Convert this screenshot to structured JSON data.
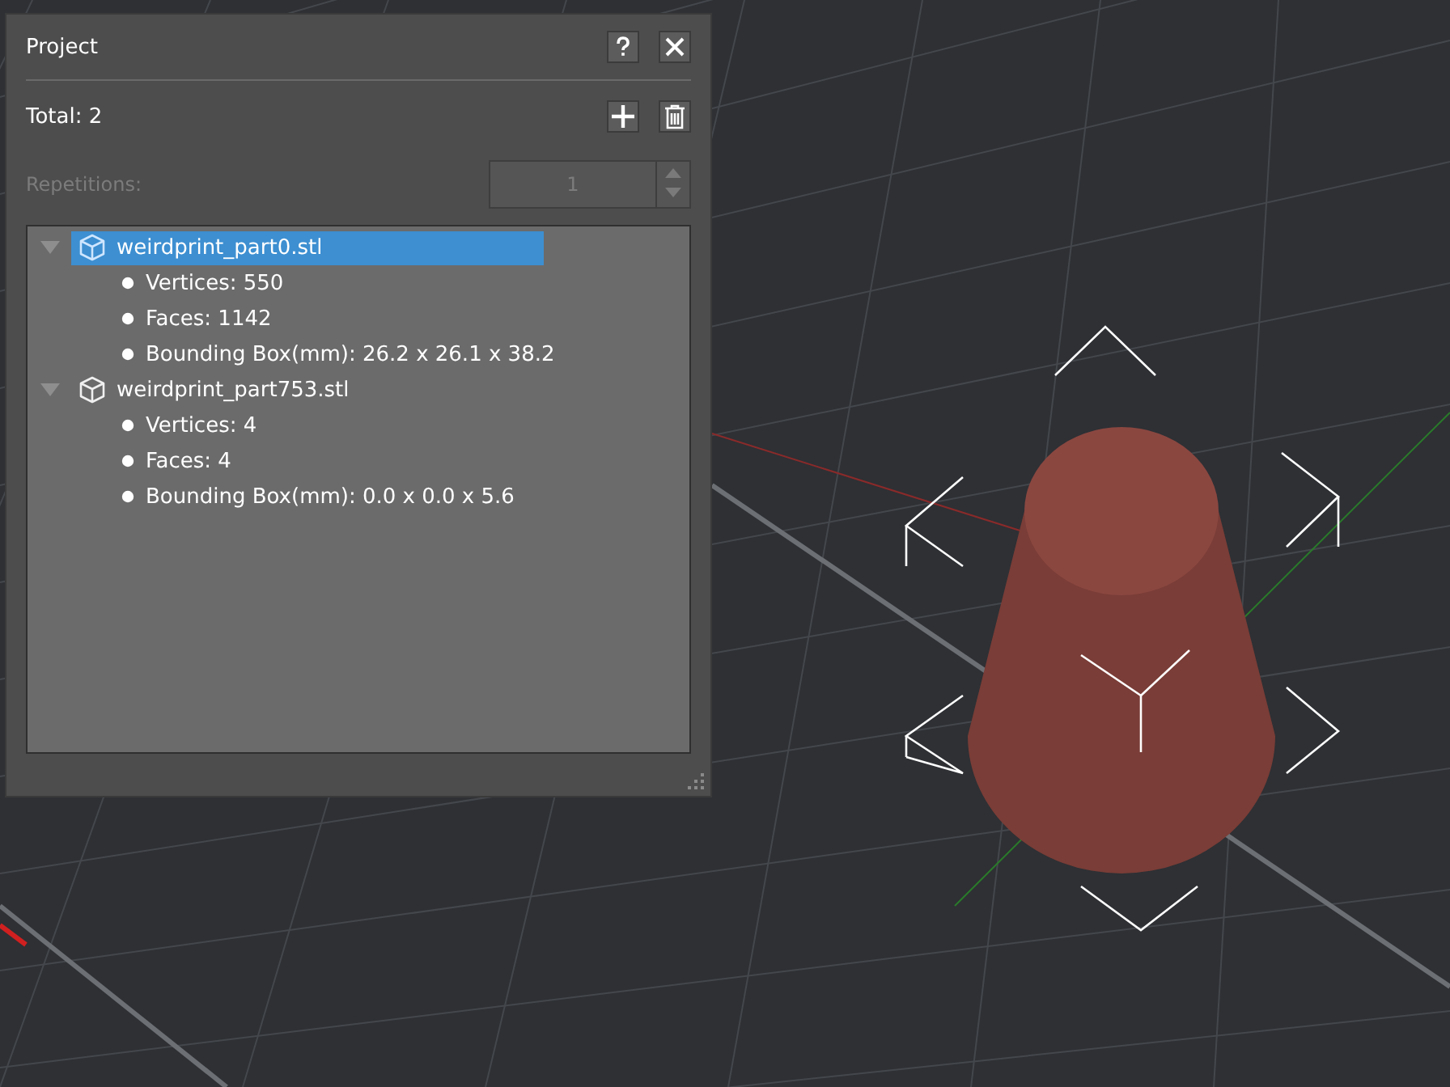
{
  "panel": {
    "title": "Project",
    "total_label": "Total: 2",
    "repetitions": {
      "label": "Repetitions:",
      "value": "1",
      "disabled": true
    },
    "files": [
      {
        "name": "weirdprint_part0.stl",
        "selected": true,
        "expanded": true,
        "children": [
          "Vertices: 550",
          "Faces: 1142",
          "Bounding Box(mm): 26.2 x 26.1 x 38.2"
        ]
      },
      {
        "name": "weirdprint_part753.stl",
        "selected": false,
        "expanded": true,
        "children": [
          "Vertices: 4",
          "Faces: 4",
          "Bounding Box(mm): 0.0 x 0.0 x 5.6"
        ]
      }
    ]
  }
}
